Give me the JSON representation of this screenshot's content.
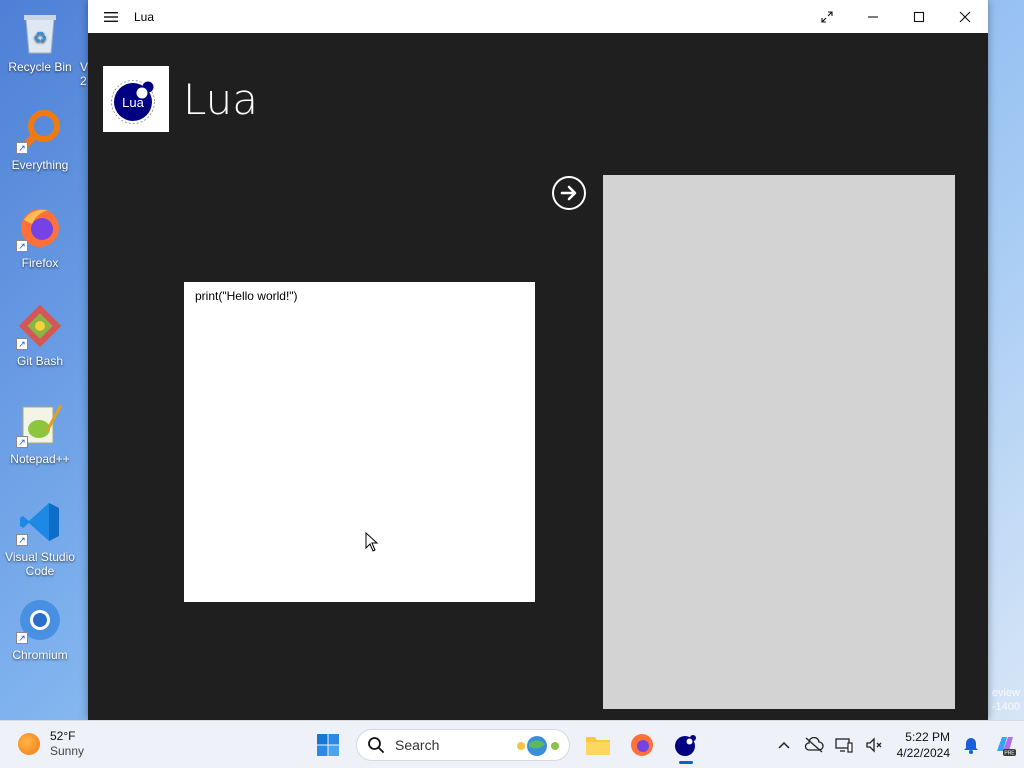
{
  "desktop": {
    "icons": [
      {
        "label": "Recycle Bin",
        "icon": "recycle-bin-icon"
      },
      {
        "label": "Everything",
        "icon": "everything-icon"
      },
      {
        "label": "Firefox",
        "icon": "firefox-icon"
      },
      {
        "label": "Git Bash",
        "icon": "git-bash-icon"
      },
      {
        "label": "Notepad++",
        "icon": "notepad-plus-plus-icon"
      },
      {
        "label": "Visual Studio Code",
        "icon": "vscode-icon"
      },
      {
        "label": "Chromium",
        "icon": "chromium-icon"
      }
    ],
    "partial_label_top": "V",
    "partial_label_bottom": "2",
    "watermark_line1": "eview",
    "watermark_line2": "-1400"
  },
  "window": {
    "title": "Lua",
    "app_name": "Lua",
    "logo_text": "Lua",
    "code": "print(\"Hello world!\")",
    "colors": {
      "background": "#1f1f1f",
      "output_pane": "#d3d3d3",
      "logo_navy": "#000080"
    }
  },
  "taskbar": {
    "weather": {
      "temp": "52°F",
      "condition": "Sunny"
    },
    "search_label": "Search",
    "clock": {
      "time": "5:22 PM",
      "date": "4/22/2024"
    }
  }
}
